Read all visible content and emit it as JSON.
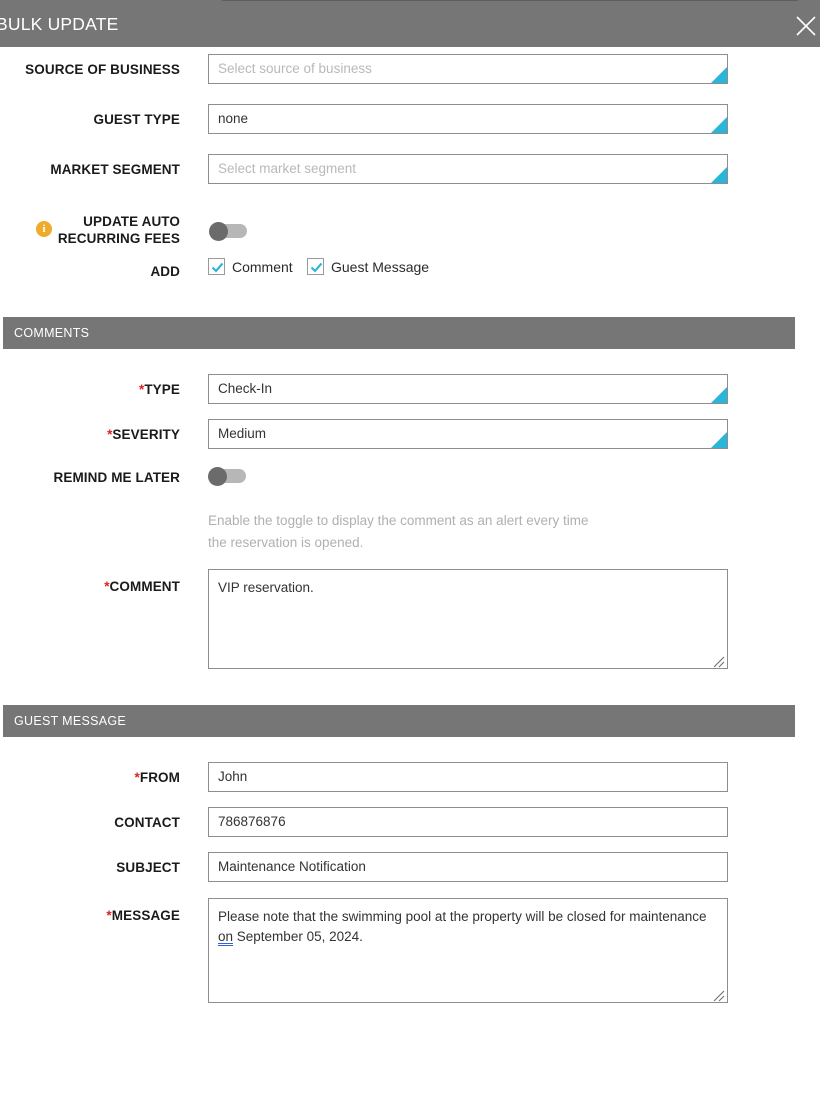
{
  "modal": {
    "title": "BULK UPDATE",
    "close_icon": "close-icon"
  },
  "form": {
    "source_of_business": {
      "label": "SOURCE OF BUSINESS",
      "placeholder": "Select source of business",
      "value": ""
    },
    "guest_type": {
      "label": "GUEST TYPE",
      "value": "none"
    },
    "market_segment": {
      "label": "MARKET SEGMENT",
      "placeholder": "Select market segment",
      "value": ""
    },
    "update_auto_recurring_fees": {
      "label_line1": "UPDATE AUTO",
      "label_line2": "RECURRING FEES",
      "info_icon": "info-icon",
      "info_glyph": "i",
      "toggle_state": "off"
    },
    "add": {
      "label": "ADD",
      "options": [
        {
          "label": "Comment",
          "checked": true
        },
        {
          "label": "Guest Message",
          "checked": true
        }
      ]
    }
  },
  "comments_section": {
    "header": "COMMENTS",
    "type": {
      "label": "TYPE",
      "required": "*",
      "value": "Check-In"
    },
    "severity": {
      "label": "SEVERITY",
      "required": "*",
      "value": "Medium"
    },
    "remind_me_later": {
      "label": "REMIND ME LATER",
      "toggle_state": "off"
    },
    "helper_line1": "Enable the toggle to display the comment as an alert every time",
    "helper_line2": "the reservation is opened.",
    "comment": {
      "label": "COMMENT",
      "required": "*",
      "value": "VIP reservation."
    }
  },
  "guest_message_section": {
    "header": "GUEST MESSAGE",
    "from": {
      "label": "FROM",
      "required": "*",
      "value": "John"
    },
    "contact": {
      "label": "CONTACT",
      "value": "786876876"
    },
    "subject": {
      "label": "SUBJECT",
      "value": "Maintenance Notification"
    },
    "message": {
      "label": "MESSAGE",
      "required": "*",
      "text_before": "Please note that the swimming pool at the property will be closed for maintenance ",
      "grammar_word": "on",
      "text_after": " September 05, 2024."
    }
  },
  "colors": {
    "header_gray": "#767676",
    "dropdown_accent": "#29b6d8",
    "required_red": "#e02020",
    "info_amber": "#efab2b",
    "grammar_underline": "#2f63d8"
  }
}
